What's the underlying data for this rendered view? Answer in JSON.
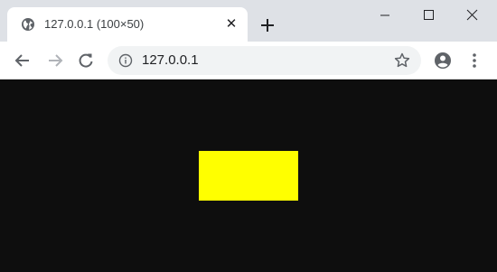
{
  "tab": {
    "title": "127.0.0.1 (100×50)",
    "close_label": "✕"
  },
  "toolbar": {
    "url": "127.0.0.1"
  },
  "icons": {
    "favicon": "globe-icon",
    "new_tab": "plus-icon",
    "back": "arrow-left-icon",
    "forward": "arrow-right-icon",
    "reload": "reload-icon",
    "info": "info-icon",
    "bookmark": "star-icon",
    "profile": "account-icon",
    "menu": "kebab-menu-icon",
    "minimize": "minimize-icon",
    "maximize": "maximize-icon",
    "close": "close-icon"
  },
  "page": {
    "background_color": "#0e0e0e",
    "rect_color": "#ffff00"
  }
}
